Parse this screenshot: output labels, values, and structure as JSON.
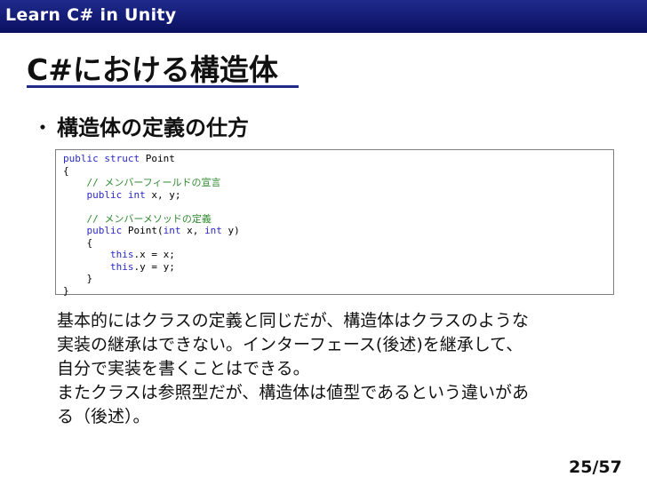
{
  "header": {
    "title": "Learn C# in Unity"
  },
  "slide": {
    "title": "C#における構造体",
    "bullet": "・",
    "bullet_text": "構造体の定義の仕方"
  },
  "code": {
    "lines": [
      [
        {
          "t": "public struct",
          "c": "kw"
        },
        {
          "t": " Point"
        }
      ],
      [
        {
          "t": "{"
        }
      ],
      [
        {
          "t": "    "
        },
        {
          "t": "// メンバーフィールドの宣言",
          "c": "cm"
        }
      ],
      [
        {
          "t": "    "
        },
        {
          "t": "public int",
          "c": "kw"
        },
        {
          "t": " x, y;"
        }
      ],
      [
        {
          "t": ""
        }
      ],
      [
        {
          "t": "    "
        },
        {
          "t": "// メンバーメソッドの定義",
          "c": "cm"
        }
      ],
      [
        {
          "t": "    "
        },
        {
          "t": "public",
          "c": "kw"
        },
        {
          "t": " Point("
        },
        {
          "t": "int",
          "c": "kw"
        },
        {
          "t": " x, "
        },
        {
          "t": "int",
          "c": "kw"
        },
        {
          "t": " y)"
        }
      ],
      [
        {
          "t": "    {"
        }
      ],
      [
        {
          "t": "        "
        },
        {
          "t": "this",
          "c": "kw"
        },
        {
          "t": ".x = x;"
        }
      ],
      [
        {
          "t": "        "
        },
        {
          "t": "this",
          "c": "kw"
        },
        {
          "t": ".y = y;"
        }
      ],
      [
        {
          "t": "    }"
        }
      ],
      [
        {
          "t": "}"
        }
      ]
    ]
  },
  "body": {
    "lines": [
      "基本的にはクラスの定義と同じだが、構造体はクラスのような",
      "実装の継承はできない。インターフェース(後述)を継承して、",
      "自分で実装を書くことはできる。",
      "またクラスは参照型だが、構造体は値型であるという違いがあ",
      "る（後述）。"
    ]
  },
  "page": {
    "number": "25/57"
  },
  "colors": {
    "header_bg": "#1f2a8c",
    "keyword": "#2929c8",
    "comment": "#2f8a2f"
  }
}
